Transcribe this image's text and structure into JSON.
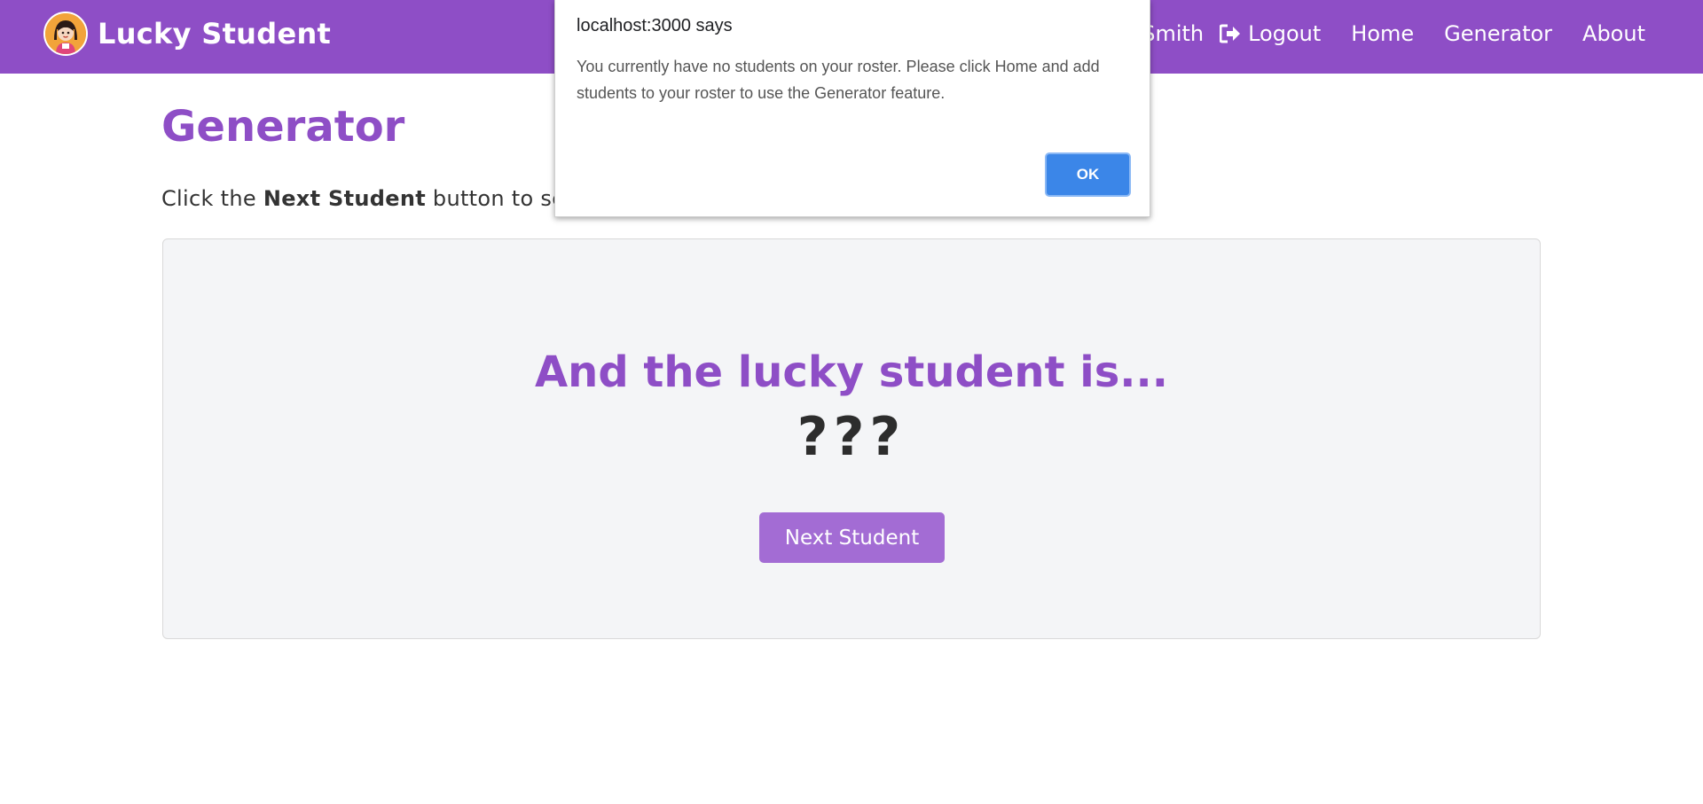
{
  "navbar": {
    "brand_title": "Lucky Student",
    "user_name": "Smith",
    "logout_label": "Logout",
    "links": {
      "home": "Home",
      "generator": "Generator",
      "about": "About"
    }
  },
  "page": {
    "title": "Generator",
    "instructions_prefix": "Click the ",
    "instructions_bold": "Next Student",
    "instructions_suffix": " button to sele"
  },
  "card": {
    "heading": "And the lucky student is...",
    "result": "???",
    "button_label": "Next Student"
  },
  "dialog": {
    "title": "localhost:3000 says",
    "message": "You currently have no students on your roster. Please click Home and add students to your roster to use the Generator feature.",
    "ok_label": "OK"
  },
  "colors": {
    "brand_purple": "#8e4ec6",
    "button_purple": "#a36cd4",
    "dialog_blue": "#3b86e8",
    "card_background": "#f4f5f7"
  },
  "icons": {
    "brand": "student-avatar-icon",
    "logout": "sign-out-icon"
  }
}
